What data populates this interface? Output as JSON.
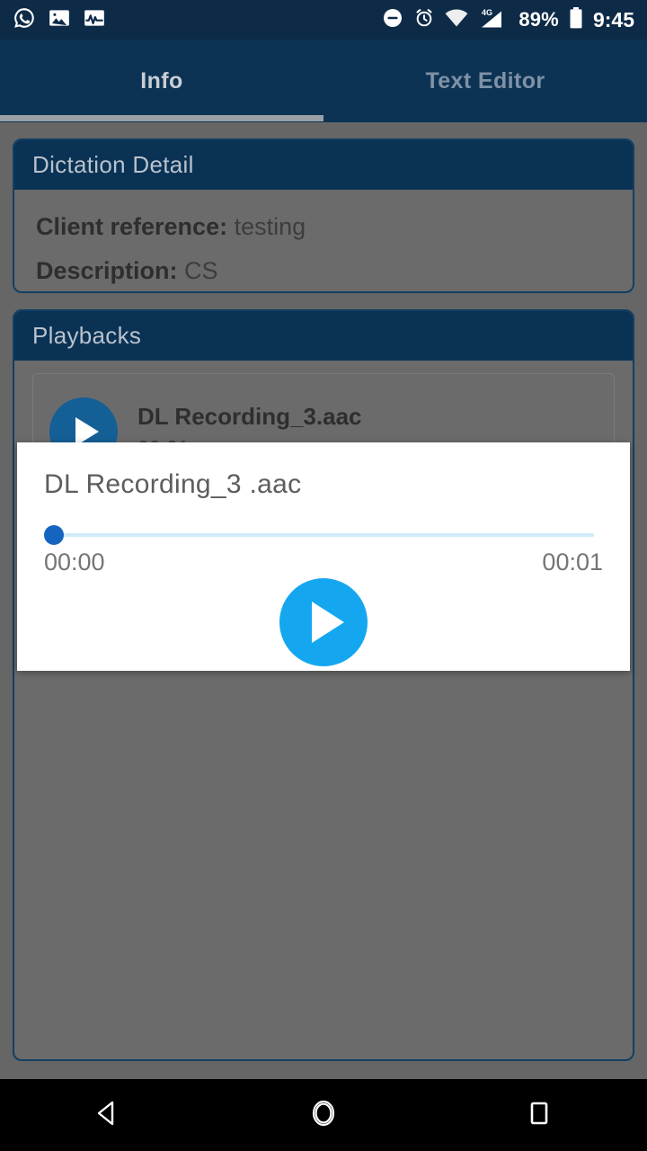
{
  "status_bar": {
    "left_icons": [
      "whatsapp-icon",
      "photo-icon",
      "pulse-icon"
    ],
    "right_icons": [
      "do-not-disturb-icon",
      "alarm-icon",
      "wifi-icon",
      "signal-4g-icon",
      "battery-icon"
    ],
    "network_label": "4G",
    "battery_percent": "89%",
    "clock": "9:45",
    "background_color": "#0d2a47"
  },
  "tabs": [
    {
      "label": "Info",
      "active": true
    },
    {
      "label": "Text Editor",
      "active": false
    }
  ],
  "cards": {
    "dictation_detail": {
      "title": "Dictation Detail",
      "rows": [
        {
          "label": "Client reference:",
          "value": "testing"
        },
        {
          "label": "Description:",
          "value": "CS"
        }
      ]
    },
    "playbacks": {
      "title": "Playbacks",
      "items": [
        {
          "name": "DL Recording_3.aac",
          "duration": "00:01",
          "play_icon": "play-icon"
        }
      ]
    }
  },
  "dialog": {
    "title": "DL Recording_3 .aac",
    "current_time": "00:00",
    "total_time": "00:01",
    "progress_percent": 0,
    "play_icon": "play-icon",
    "accent_color": "#14a7f0",
    "thumb_color": "#1565c0",
    "track_color": "#cfeaf8"
  },
  "nav_bar": {
    "buttons": [
      {
        "name": "back-button",
        "icon": "triangle-back-icon"
      },
      {
        "name": "home-button",
        "icon": "circle-home-icon"
      },
      {
        "name": "recents-button",
        "icon": "square-recents-icon"
      }
    ]
  },
  "theme": {
    "header_navy": "#0a3254",
    "tabbar_navy": "#0d3354",
    "dim_overlay": "#666666"
  }
}
